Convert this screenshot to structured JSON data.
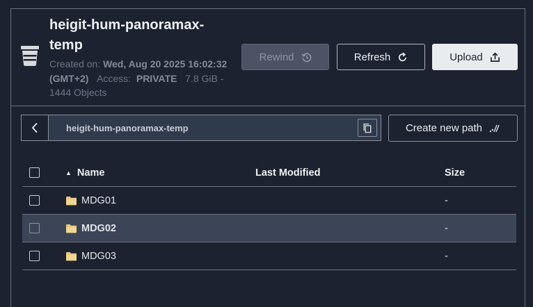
{
  "bucket": {
    "title": "heigit-hum-panoramax-temp",
    "created_label": "Created on:",
    "created_value": "Wed, Aug 20 2025 16:02:32 (GMT+2)",
    "access_label": "Access:",
    "access_value": "PRIVATE",
    "size": "7.8 GiB",
    "separator": "-",
    "objects": "1444 Objects"
  },
  "actions": {
    "rewind_label": "Rewind",
    "refresh_label": "Refresh",
    "upload_label": "Upload"
  },
  "path": {
    "current": "heigit-hum-panoramax-temp",
    "create_label": "Create new path"
  },
  "table": {
    "columns": {
      "name": "Name",
      "modified": "Last Modified",
      "size": "Size"
    },
    "rows": [
      {
        "name": "MDG01",
        "modified": "",
        "size": "-"
      },
      {
        "name": "MDG02",
        "modified": "",
        "size": "-"
      },
      {
        "name": "MDG03",
        "modified": "",
        "size": "-"
      }
    ]
  },
  "icons": [
    "bucket-icon",
    "history-icon",
    "refresh-icon",
    "upload-icon",
    "chevron-left-icon",
    "copy-icon",
    "new-path-icon",
    "sort-asc-icon",
    "folder-icon"
  ],
  "colors": {
    "background": "#1c2230",
    "selected_row": "#3b4557",
    "folder": "#e7c77d"
  }
}
